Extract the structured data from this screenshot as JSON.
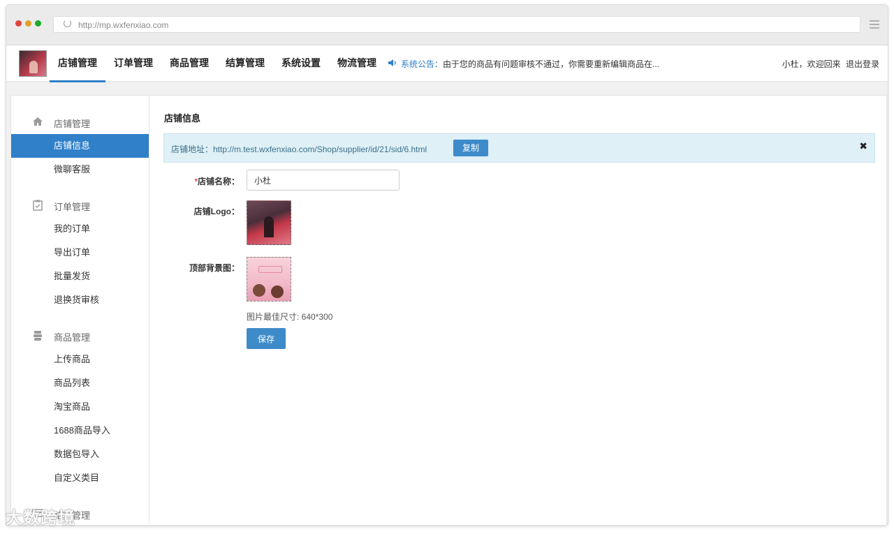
{
  "browser": {
    "url": "http://mp.wxfenxiao.com",
    "dot_colors": [
      "#e0443e",
      "#dea123",
      "#1aab29"
    ]
  },
  "topnav": {
    "items": [
      "店铺管理",
      "订单管理",
      "商品管理",
      "结算管理",
      "系统设置",
      "物流管理"
    ],
    "active_index": 0,
    "notice_label": "系统公告：",
    "notice_text": "由于您的商品有问题审核不通过，你需要重新编辑商品在...",
    "user_greeting": "小杜，欢迎回来",
    "logout": "退出登录"
  },
  "sidebar": {
    "groups": [
      {
        "icon": "home-icon",
        "label": "店铺管理",
        "items": [
          "店铺信息",
          "微聊客服"
        ]
      },
      {
        "icon": "clipboard-check-icon",
        "label": "订单管理",
        "items": [
          "我的订单",
          "导出订单",
          "批量发货",
          "退换货审核"
        ]
      },
      {
        "icon": "stack-icon",
        "label": "商品管理",
        "items": [
          "上传商品",
          "商品列表",
          "淘宝商品",
          "1688商品导入",
          "数据包导入",
          "自定义类目"
        ]
      },
      {
        "icon": "settlement-icon",
        "label": "结算管理",
        "items": []
      }
    ],
    "active_item": "店铺信息"
  },
  "main": {
    "title": "店铺信息",
    "alert_text": "店铺地址：http://m.test.wxfenxiao.com/Shop/supplier/id/21/sid/6.html",
    "copy_label": "复制",
    "close_symbol": "✖",
    "store_name_label": "店铺名称：",
    "store_name_required": "*",
    "store_name_value": "小杜",
    "logo_label": "店铺Logo：",
    "bg_label": "顶部背景图：",
    "hint": "图片最佳尺寸: 640*300",
    "save_label": "保存"
  },
  "watermark": "大数跨境",
  "colors": {
    "accent": "#2f80c9",
    "alert_bg": "#dff0f7",
    "button": "#3e8bc9"
  }
}
